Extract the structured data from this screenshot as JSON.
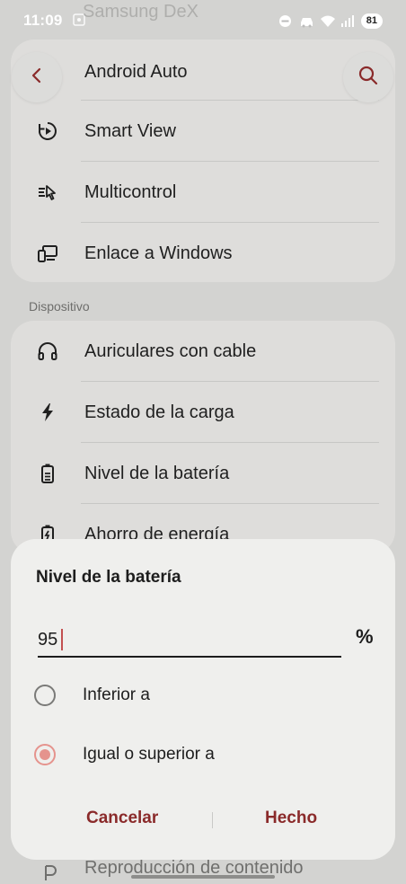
{
  "status_bar": {
    "time": "11:09",
    "battery": "81"
  },
  "header": {
    "ghost_title": "Samsung DeX"
  },
  "connections": {
    "items": [
      {
        "label": "Android Auto",
        "icon": "android-auto-icon"
      },
      {
        "label": "Smart View",
        "icon": "smart-view-icon"
      },
      {
        "label": "Multicontrol",
        "icon": "multicontrol-icon"
      },
      {
        "label": "Enlace a Windows",
        "icon": "link-to-windows-icon"
      }
    ]
  },
  "device_section": {
    "title": "Dispositivo",
    "items": [
      {
        "label": "Auriculares con cable",
        "icon": "headphones-icon"
      },
      {
        "label": "Estado de la carga",
        "icon": "bolt-icon"
      },
      {
        "label": "Nivel de la batería",
        "icon": "battery-icon"
      },
      {
        "label": "Ahorro de energía",
        "icon": "power-saving-icon"
      }
    ]
  },
  "dialog": {
    "title": "Nivel de la batería",
    "value": "95",
    "unit": "%",
    "options": [
      {
        "label": "Inferior a",
        "selected": false
      },
      {
        "label": "Igual o superior a",
        "selected": true
      }
    ],
    "cancel_label": "Cancelar",
    "done_label": "Hecho"
  },
  "background_footer": {
    "label": "Reproducción de contenido"
  },
  "colors": {
    "accent": "#8a2a2a",
    "radio_selected": "#e5938d",
    "background": "#d3d3d1",
    "sheet": "#efefed"
  }
}
